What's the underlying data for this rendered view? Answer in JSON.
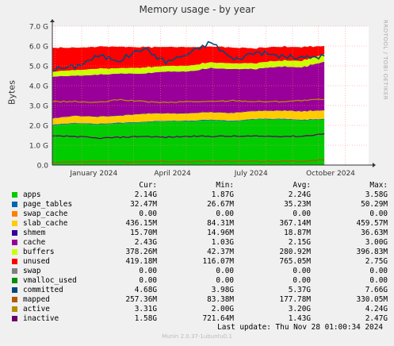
{
  "chart_data": {
    "type": "area",
    "title": "Memory usage - by year",
    "ylabel": "Bytes",
    "yticks": [
      "0.0",
      "1.0 G",
      "2.0 G",
      "3.0 G",
      "4.0 G",
      "5.0 G",
      "6.0 G",
      "7.0 G"
    ],
    "ylim": [
      0,
      7.0
    ],
    "xtick_labels": [
      "January 2024",
      "April 2024",
      "July 2024",
      "October 2024"
    ],
    "x_range": [
      "2023-11-28",
      "2024-11-28"
    ],
    "grid": true,
    "series": [
      {
        "name": "apps",
        "values": [
          2.0,
          2.1,
          2.05,
          2.1,
          2.15,
          2.2,
          2.2,
          2.25,
          2.2,
          2.3,
          2.3,
          2.25,
          2.3
        ]
      },
      {
        "name": "page_tables",
        "values": [
          0.035,
          0.035,
          0.035,
          0.035,
          0.035,
          0.035,
          0.035,
          0.035,
          0.035,
          0.035,
          0.035,
          0.035,
          0.032
        ]
      },
      {
        "name": "swap_cache",
        "values": [
          0,
          0,
          0,
          0,
          0,
          0,
          0,
          0,
          0,
          0,
          0,
          0,
          0
        ]
      },
      {
        "name": "slab_cache",
        "values": [
          0.3,
          0.35,
          0.35,
          0.35,
          0.4,
          0.37,
          0.36,
          0.37,
          0.38,
          0.4,
          0.4,
          0.42,
          0.43
        ]
      },
      {
        "name": "shmem",
        "values": [
          0.02,
          0.02,
          0.02,
          0.02,
          0.02,
          0.02,
          0.02,
          0.02,
          0.02,
          0.02,
          0.02,
          0.02,
          0.016
        ]
      },
      {
        "name": "cache",
        "values": [
          2.1,
          2.0,
          2.1,
          2.1,
          2.0,
          2.1,
          2.1,
          2.2,
          2.2,
          2.1,
          2.2,
          2.2,
          2.43
        ]
      },
      {
        "name": "buffers",
        "values": [
          0.25,
          0.28,
          0.3,
          0.28,
          0.3,
          0.28,
          0.29,
          0.29,
          0.29,
          0.3,
          0.3,
          0.33,
          0.38
        ]
      },
      {
        "name": "unused",
        "values": [
          1.2,
          1.12,
          1.1,
          1.07,
          1.03,
          0.95,
          0.93,
          0.8,
          0.79,
          0.75,
          0.7,
          0.68,
          0.42
        ]
      },
      {
        "name": "swap",
        "values": [
          0,
          0,
          0,
          0,
          0,
          0,
          0,
          0,
          0,
          0,
          0,
          0,
          0
        ]
      },
      {
        "name": "vmalloc_used",
        "values": [
          0,
          0,
          0,
          0,
          0,
          0,
          0,
          0,
          0,
          0,
          0,
          0,
          0
        ]
      },
      {
        "name": "committed",
        "values": [
          4.85,
          4.95,
          5.5,
          5.3,
          5.9,
          5.2,
          5.6,
          6.2,
          5.3,
          5.7,
          5.5,
          5.4,
          5.5
        ]
      },
      {
        "name": "mapped",
        "values": [
          0.15,
          0.16,
          0.17,
          0.17,
          0.17,
          0.18,
          0.18,
          0.18,
          0.18,
          0.18,
          0.19,
          0.2,
          0.26
        ]
      },
      {
        "name": "active",
        "values": [
          3.2,
          3.2,
          3.15,
          3.3,
          3.2,
          3.15,
          3.2,
          3.2,
          3.25,
          3.2,
          3.2,
          3.25,
          3.31
        ]
      },
      {
        "name": "inactive",
        "values": [
          1.45,
          1.45,
          1.35,
          1.4,
          1.45,
          1.4,
          1.45,
          1.45,
          1.45,
          1.45,
          1.45,
          1.45,
          1.58
        ]
      }
    ]
  },
  "legend": {
    "headers": [
      "",
      "Cur:",
      "Min:",
      "Avg:",
      "Max:"
    ],
    "rows": [
      {
        "name": "apps",
        "color": "#00cc00",
        "cur": "2.14G",
        "min": "1.87G",
        "avg": "2.24G",
        "max": "3.58G"
      },
      {
        "name": "page_tables",
        "color": "#0066b3",
        "cur": "32.47M",
        "min": "26.67M",
        "avg": "35.23M",
        "max": "50.29M"
      },
      {
        "name": "swap_cache",
        "color": "#ff8000",
        "cur": "0.00",
        "min": "0.00",
        "avg": "0.00",
        "max": "0.00"
      },
      {
        "name": "slab_cache",
        "color": "#ffcc00",
        "cur": "436.15M",
        "min": "84.31M",
        "avg": "367.14M",
        "max": "459.57M"
      },
      {
        "name": "shmem",
        "color": "#330099",
        "cur": "15.70M",
        "min": "14.96M",
        "avg": "18.87M",
        "max": "36.63M"
      },
      {
        "name": "cache",
        "color": "#990099",
        "cur": "2.43G",
        "min": "1.03G",
        "avg": "2.15G",
        "max": "3.00G"
      },
      {
        "name": "buffers",
        "color": "#ccff00",
        "cur": "378.26M",
        "min": "42.37M",
        "avg": "280.92M",
        "max": "396.83M"
      },
      {
        "name": "unused",
        "color": "#ff0000",
        "cur": "419.18M",
        "min": "116.07M",
        "avg": "765.05M",
        "max": "2.75G"
      },
      {
        "name": "swap",
        "color": "#808080",
        "cur": "0.00",
        "min": "0.00",
        "avg": "0.00",
        "max": "0.00"
      },
      {
        "name": "vmalloc_used",
        "color": "#008f00",
        "cur": "0.00",
        "min": "0.00",
        "avg": "0.00",
        "max": "0.00"
      },
      {
        "name": "committed",
        "color": "#00487d",
        "cur": "4.68G",
        "min": "3.98G",
        "avg": "5.37G",
        "max": "7.66G"
      },
      {
        "name": "mapped",
        "color": "#b35a00",
        "cur": "257.36M",
        "min": "83.38M",
        "avg": "177.78M",
        "max": "330.05M"
      },
      {
        "name": "active",
        "color": "#b38f00",
        "cur": "3.31G",
        "min": "2.00G",
        "avg": "3.20G",
        "max": "4.24G"
      },
      {
        "name": "inactive",
        "color": "#6b006b",
        "cur": "1.58G",
        "min": "721.64M",
        "avg": "1.43G",
        "max": "2.47G"
      }
    ]
  },
  "last_update": "Last update: Thu Nov 28 01:00:34 2024",
  "side_label": "RRDTOOL / TOBI OETIKER",
  "footer": "Munin 2.0.37-1ubuntu0.1"
}
